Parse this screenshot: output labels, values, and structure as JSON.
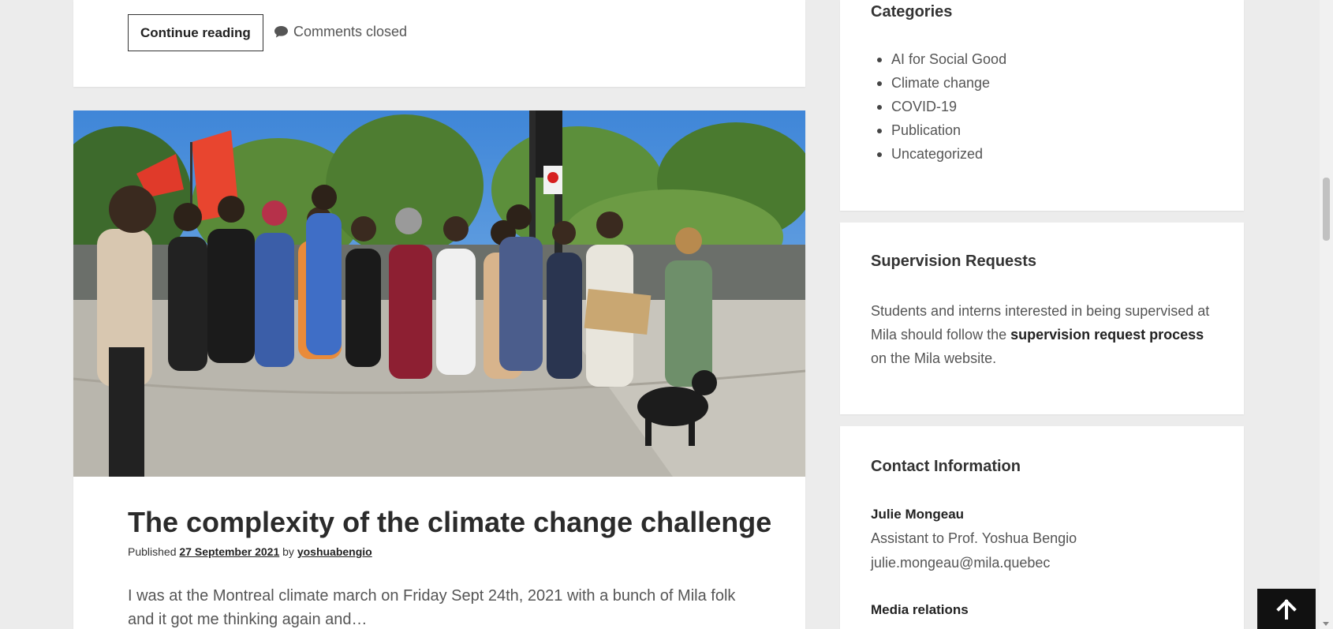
{
  "previous_post": {
    "continue_label": "Continue reading",
    "comments_label": "Comments closed"
  },
  "post": {
    "title": "The complexity of the climate change challenge",
    "published_prefix": "Published",
    "date": "27 September 2021",
    "by_prefix": "by",
    "author": "yoshuabengio",
    "excerpt": "I was at the Montreal climate march on Friday Sept 24th, 2021 with a bunch of Mila folk and it got me thinking again and…"
  },
  "sidebar": {
    "categories": {
      "title": "Categories",
      "items": [
        "AI for Social Good",
        "Climate change",
        "COVID-19",
        "Publication",
        "Uncategorized"
      ]
    },
    "supervision": {
      "title": "Supervision Requests",
      "text_before": "Students and interns interested in being supervised at Mila should follow the ",
      "link": "supervision request process",
      "text_after": " on the Mila website."
    },
    "contact": {
      "title": "Contact Information",
      "name": "Julie Mongeau",
      "role": "Assistant to Prof. Yoshua Bengio",
      "email": "julie.mongeau@mila.quebec",
      "media_title": "Media relations"
    }
  },
  "icons": {
    "comments": "speech-bubble-icon",
    "back_to_top": "arrow-up-icon"
  },
  "colors": {
    "background": "#ececec",
    "card": "#ffffff",
    "text": "#333333",
    "back_to_top_bg": "#111111"
  }
}
